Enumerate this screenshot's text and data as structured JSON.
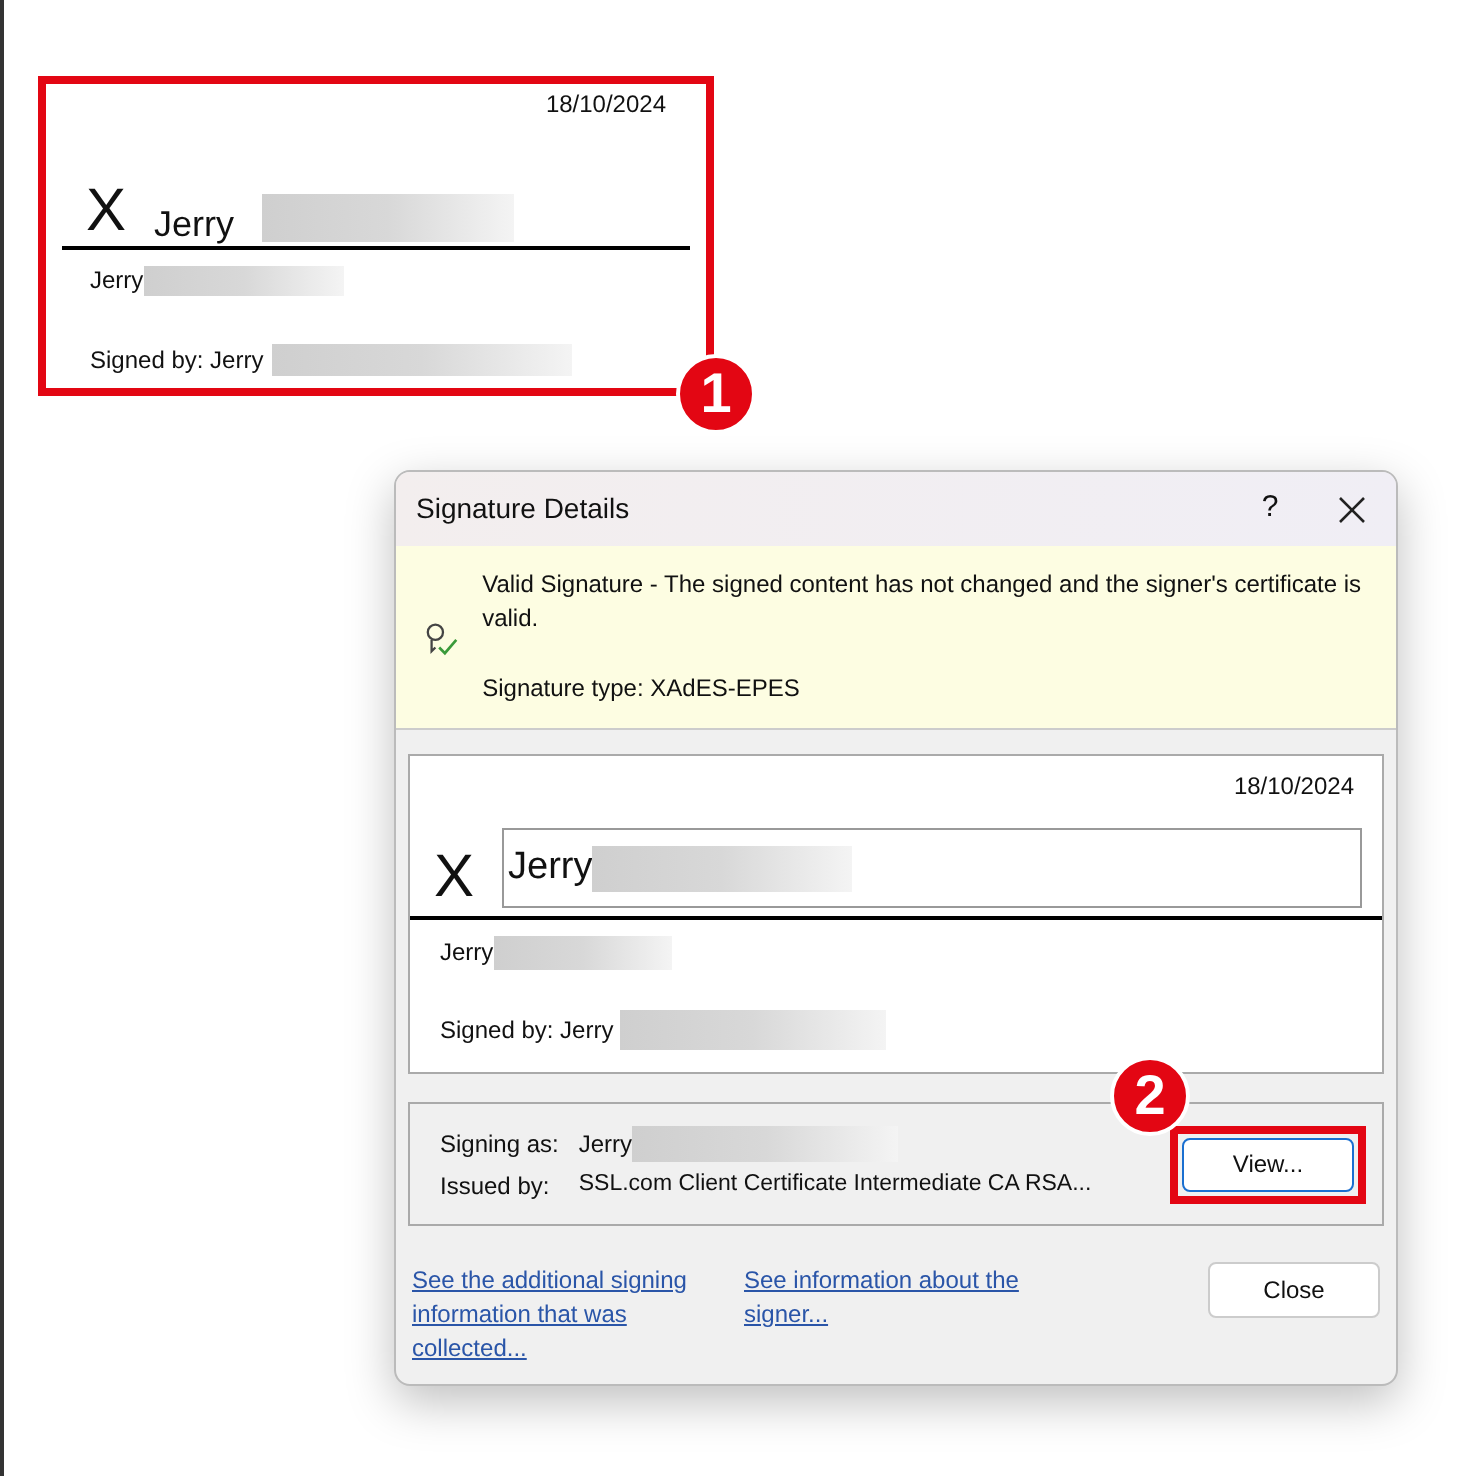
{
  "document": {
    "signature_line": {
      "date": "18/10/2024",
      "x_mark": "X",
      "signer_name": "Jerry",
      "printed_name": "Jerry",
      "signed_by": "Signed by: Jerry"
    },
    "callout": "1"
  },
  "dialog": {
    "title": "Signature Details",
    "help_button": "?",
    "banner": {
      "status": "Valid Signature - The signed content has not changed and the signer's certificate is valid.",
      "signature_type": "Signature type: XAdES-EPES"
    },
    "preview": {
      "date": "18/10/2024",
      "x_mark": "X",
      "signer_name": "Jerry",
      "printed_name": "Jerry",
      "signed_by": "Signed by: Jerry"
    },
    "certificate": {
      "signing_as_label": "Signing as:",
      "signing_as_value": "Jerry",
      "issued_by_label": "Issued by:",
      "issued_by_value": "SSL.com Client Certificate Intermediate CA RSA...",
      "view_button": "View...",
      "callout": "2"
    },
    "links": [
      "See the additional signing information that was collected...",
      "See information about the signer..."
    ],
    "close_button": "Close"
  }
}
